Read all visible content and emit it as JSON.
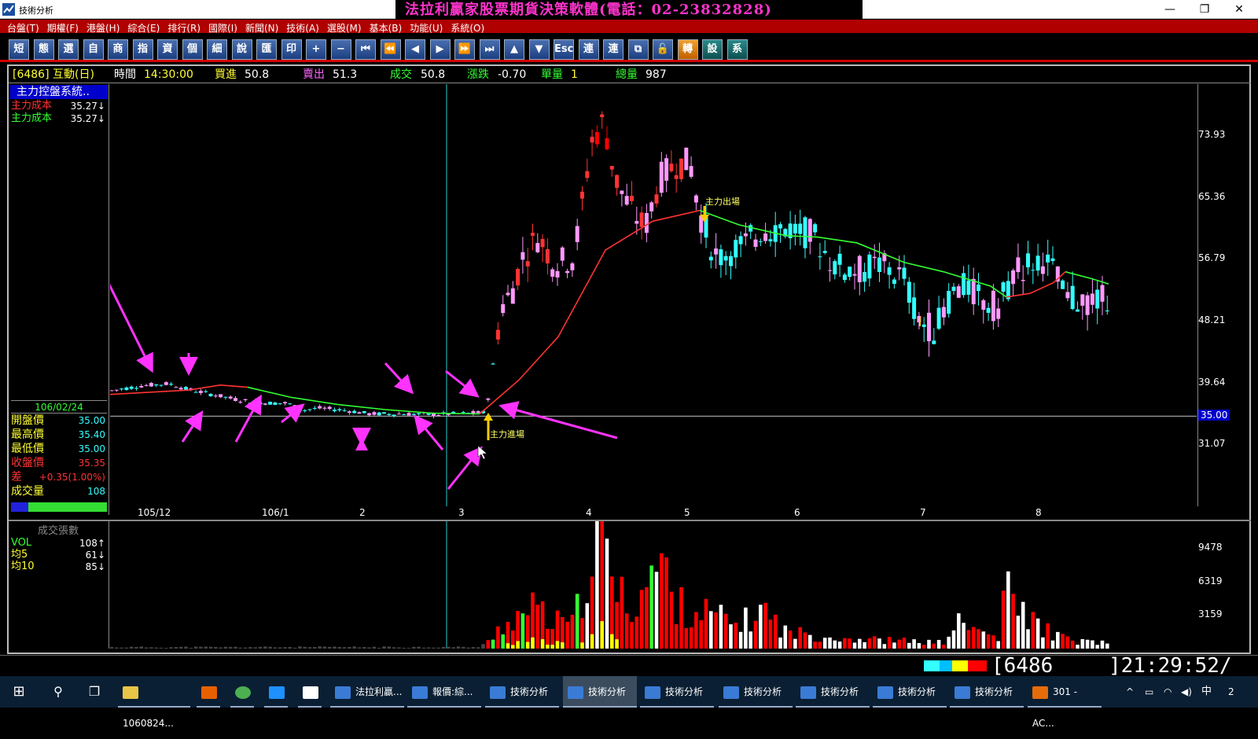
{
  "window": {
    "title": "技術分析",
    "banner": "法拉利贏家股票期貨決策軟體(電話：02-23832828)",
    "controls": {
      "minimize": "—",
      "restore": "❐",
      "close": "✕"
    }
  },
  "menu": [
    "台盤(T)",
    "期權(F)",
    "港盤(H)",
    "綜合(E)",
    "排行(R)",
    "國際(I)",
    "新聞(N)",
    "技術(A)",
    "選股(M)",
    "基本(B)",
    "功能(U)",
    "系統(O)"
  ],
  "toolbar": [
    {
      "label": "短",
      "icon": "short-icon"
    },
    {
      "label": "態",
      "icon": "pattern-icon"
    },
    {
      "label": "選",
      "icon": "select-icon"
    },
    {
      "label": "自",
      "icon": "self-icon"
    },
    {
      "label": "商",
      "icon": "commodity-icon"
    },
    {
      "label": "指",
      "icon": "index-icon"
    },
    {
      "label": "資",
      "icon": "data-icon"
    },
    {
      "label": "個",
      "icon": "single-icon"
    },
    {
      "label": "細",
      "icon": "detail-icon"
    },
    {
      "label": "說",
      "icon": "explain-icon"
    },
    {
      "label": "匯",
      "icon": "exchange-icon"
    },
    {
      "label": "印",
      "icon": "print-icon"
    },
    {
      "label": "+",
      "icon": "zoom-in-icon"
    },
    {
      "label": "−",
      "icon": "zoom-out-icon"
    },
    {
      "label": "⏮",
      "icon": "first-icon"
    },
    {
      "label": "⏪",
      "icon": "rewind-icon"
    },
    {
      "label": "◀",
      "icon": "prev-icon"
    },
    {
      "label": "▶",
      "icon": "next-icon"
    },
    {
      "label": "⏩",
      "icon": "fast-forward-icon"
    },
    {
      "label": "⏭",
      "icon": "last-icon"
    },
    {
      "label": "▲",
      "icon": "up-icon"
    },
    {
      "label": "▼",
      "icon": "down-icon"
    },
    {
      "label": "Esc",
      "icon": "escape-icon"
    },
    {
      "label": "連",
      "icon": "link-icon"
    },
    {
      "label": "連",
      "icon": "link2-icon"
    },
    {
      "label": "⧉",
      "icon": "window-icon"
    },
    {
      "label": "🔓",
      "icon": "lock-icon"
    },
    {
      "label": "轉",
      "icon": "convert-icon"
    },
    {
      "label": "設",
      "icon": "settings-icon"
    },
    {
      "label": "系",
      "icon": "system-icon"
    }
  ],
  "quote": {
    "code_name": "[6486] 互動(日)",
    "time_label": "時間",
    "time": "14:30:00",
    "bid_label": "買進",
    "bid": "50.8",
    "ask_label": "賣出",
    "ask": "51.3",
    "last_label": "成交",
    "last": "50.8",
    "change_label": "漲跌",
    "change": "-0.70",
    "vol_label": "單量",
    "vol": "1",
    "total_label": "總量",
    "total": "987"
  },
  "side": {
    "system_title": "主力控盤系統..",
    "cost_rows": [
      {
        "label": "主力成本",
        "value": "35.27↓",
        "color": "#ff3333"
      },
      {
        "label": "主力成本",
        "value": "35.27↓",
        "color": "#33ff33"
      }
    ],
    "date": "106/02/24",
    "ohlc": [
      {
        "label": "開盤價",
        "value": "35.00",
        "lcolor": "#ffff33",
        "vcolor": "#33ffff"
      },
      {
        "label": "最高價",
        "value": "35.40",
        "lcolor": "#ffff33",
        "vcolor": "#33ffff"
      },
      {
        "label": "最低價",
        "value": "35.00",
        "lcolor": "#ffff33",
        "vcolor": "#33ffff"
      },
      {
        "label": "收盤價",
        "value": "35.35",
        "lcolor": "#ff3333",
        "vcolor": "#ff3333"
      },
      {
        "label": "差",
        "value": "+0.35(1.00%)",
        "lcolor": "#ff3333",
        "vcolor": "#ff3333"
      },
      {
        "label": "成交量",
        "value": "108",
        "lcolor": "#ffff33",
        "vcolor": "#33ffff"
      }
    ]
  },
  "vol_side": {
    "title": "成交張數",
    "rows": [
      {
        "label": "VOL",
        "value": "108↑",
        "lcolor": "#33ff33"
      },
      {
        "label": "均5",
        "value": "61↓",
        "lcolor": "#ffff33"
      },
      {
        "label": "均10",
        "value": "85↓",
        "lcolor": "#ffff33"
      }
    ]
  },
  "annotations": {
    "enter": "主力進場",
    "exit": "主力出場"
  },
  "chart_data": [
    {
      "type": "candlestick",
      "title": "",
      "y_ticks": [
        "73.93",
        "65.36",
        "56.79",
        "48.21",
        "39.64",
        "31.07"
      ],
      "y_range": [
        22.5,
        81
      ],
      "current_price_marker": "35.00",
      "x_ticks": [
        "105/12",
        "106/1",
        "2",
        "3",
        "4",
        "5",
        "6",
        "7",
        "8"
      ],
      "series": [
        {
          "name": "主力成本",
          "color": "#ff3333"
        },
        {
          "name": "主力成本",
          "color": "#33ff33"
        }
      ],
      "avg_line_phases": [
        {
          "color": "#ff3333",
          "values": [
            38.0,
            38.6,
            39.3,
            39.0
          ]
        },
        {
          "color": "#33ff33",
          "values": [
            39.0,
            37.6,
            36.6,
            35.9,
            35.4,
            35.3
          ]
        },
        {
          "color": "#ff3333",
          "values": [
            35.3,
            40,
            46,
            52,
            58,
            62,
            63.5
          ]
        },
        {
          "color": "#33ff33",
          "values": [
            63.5,
            61.5,
            60.0,
            59.8,
            59.0,
            56.3,
            55.0,
            53.0,
            51.5
          ]
        },
        {
          "color": "#ff3333",
          "values": [
            51.5,
            52,
            53.5,
            55.0
          ]
        },
        {
          "color": "#33ff33",
          "values": [
            55.0,
            54.0,
            53.3
          ]
        }
      ],
      "candles_summary": {
        "start": 38.5,
        "base_low": 35.0,
        "peak": 74.5,
        "exit_area": 63.5,
        "last": 50.8
      }
    },
    {
      "type": "bar",
      "title": "成交張數",
      "y_ticks": [
        "9478",
        "6319",
        "3159"
      ],
      "y_range": [
        0,
        12000
      ],
      "series": [
        {
          "name": "VOL",
          "color": "#ff0000"
        }
      ]
    }
  ],
  "status": {
    "code": "[6486",
    "clock": "]21:29:52/"
  },
  "taskbar": [
    {
      "label": "1060824...",
      "icon": "folder-icon",
      "active": false
    },
    {
      "label": "",
      "icon": "firefox-icon",
      "active": false
    },
    {
      "label": "",
      "icon": "chrome-icon",
      "active": false
    },
    {
      "label": "",
      "icon": "ie-icon",
      "active": false
    },
    {
      "label": "",
      "icon": "mail-icon",
      "active": false
    },
    {
      "label": "法拉利贏...",
      "icon": "ferrari-icon",
      "active": false
    },
    {
      "label": "報價:綜...",
      "icon": "chart-icon",
      "active": false
    },
    {
      "label": "技術分析",
      "icon": "chart-icon",
      "active": false
    },
    {
      "label": "技術分析",
      "icon": "chart-icon",
      "active": true
    },
    {
      "label": "技術分析",
      "icon": "chart-icon",
      "active": false
    },
    {
      "label": "技術分析",
      "icon": "chart-icon",
      "active": false
    },
    {
      "label": "技術分析",
      "icon": "chart-icon",
      "active": false
    },
    {
      "label": "技術分析",
      "icon": "chart-icon",
      "active": false
    },
    {
      "label": "技術分析",
      "icon": "chart-icon",
      "active": false
    },
    {
      "label": "301 - AC...",
      "icon": "office-icon",
      "active": false
    }
  ],
  "tray": {
    "ime": "中",
    "notif": "2"
  }
}
